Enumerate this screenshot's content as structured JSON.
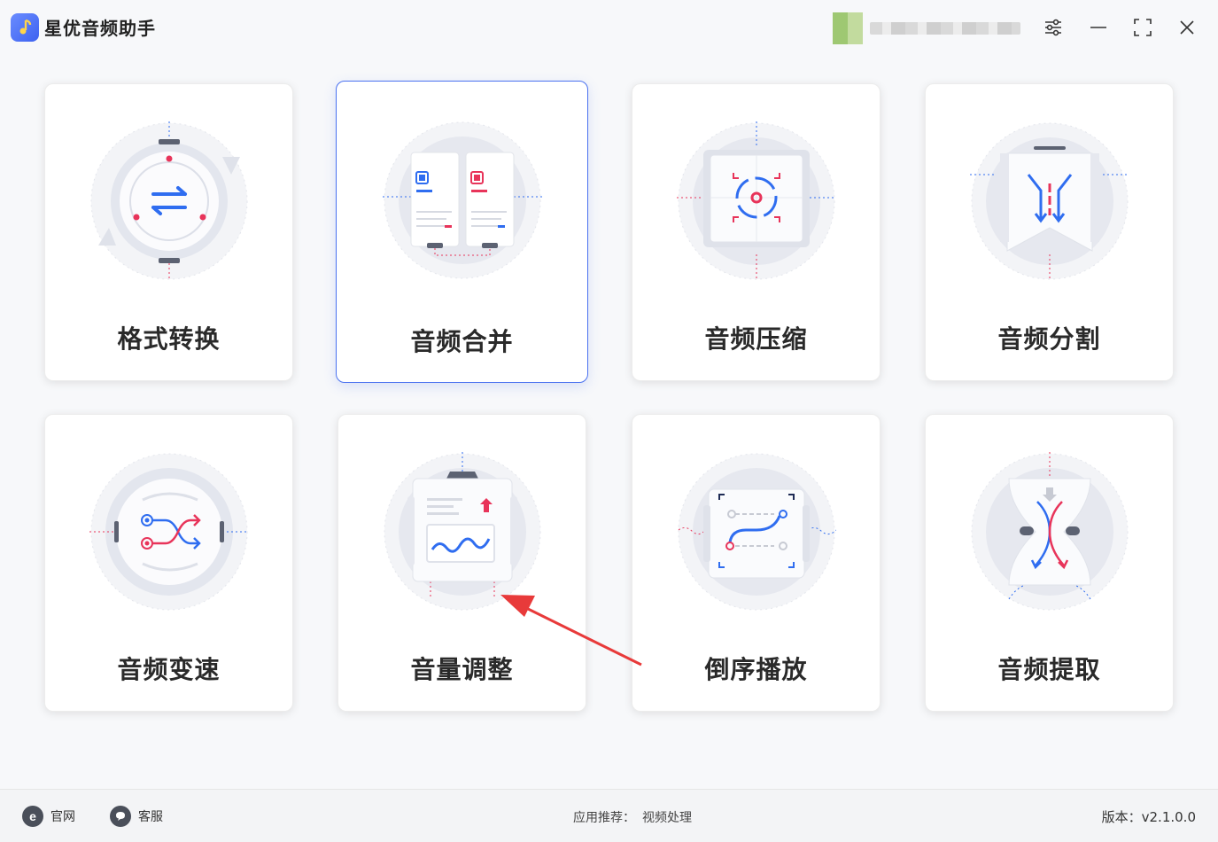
{
  "app": {
    "title": "星优音频助手"
  },
  "cards": [
    {
      "label": "格式转换",
      "icon": "format-convert-icon"
    },
    {
      "label": "音频合并",
      "icon": "audio-merge-icon"
    },
    {
      "label": "音频压缩",
      "icon": "audio-compress-icon"
    },
    {
      "label": "音频分割",
      "icon": "audio-split-icon"
    },
    {
      "label": "音频变速",
      "icon": "audio-speed-icon"
    },
    {
      "label": "音量调整",
      "icon": "volume-adjust-icon"
    },
    {
      "label": "倒序播放",
      "icon": "reverse-play-icon"
    },
    {
      "label": "音频提取",
      "icon": "audio-extract-icon"
    }
  ],
  "footer": {
    "website_label": "官网",
    "support_label": "客服",
    "recommend_label": "应用推荐：",
    "recommend_link": "视频处理",
    "version": "版本：v2.1.0.0"
  },
  "colors": {
    "accent": "#4b72f0",
    "blue": "#2f6df0",
    "red": "#e8345a"
  }
}
